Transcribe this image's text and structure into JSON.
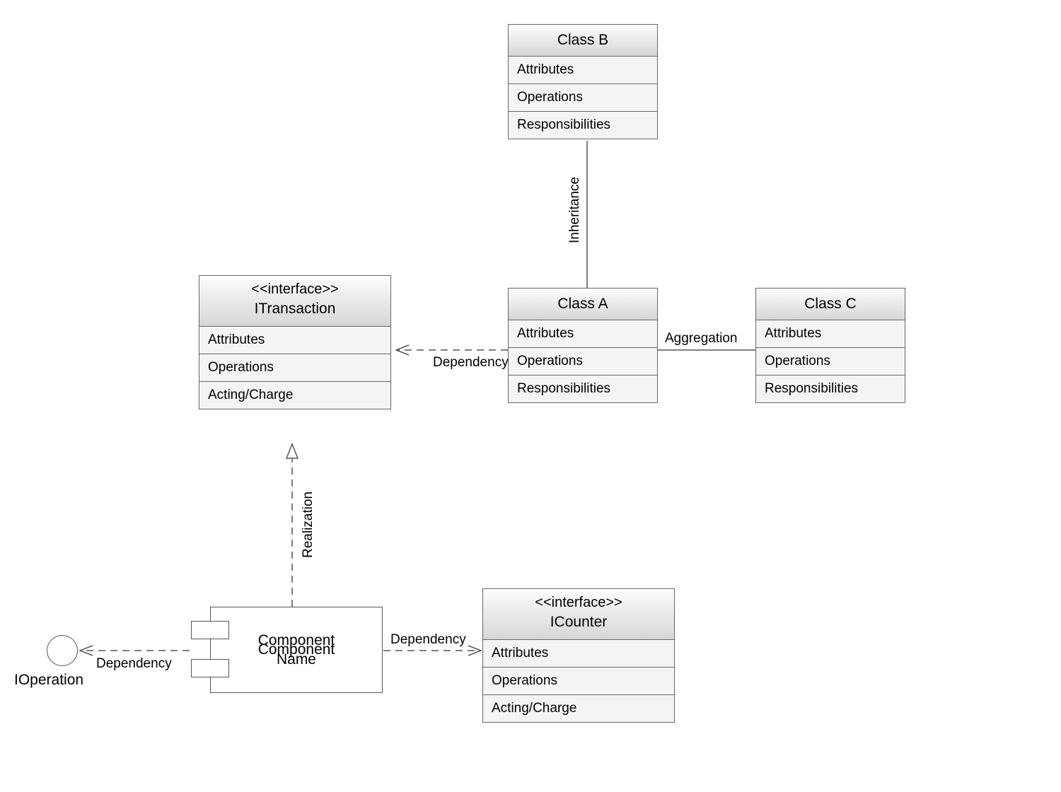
{
  "classes": {
    "itransaction": {
      "stereotype": "<<interface>>",
      "name": "ITransaction",
      "compartments": [
        "Attributes",
        "Operations",
        "Acting/Charge"
      ]
    },
    "classB": {
      "name": "Class B",
      "compartments": [
        "Attributes",
        "Operations",
        "Responsibilities"
      ]
    },
    "classA": {
      "name": "Class A",
      "compartments": [
        "Attributes",
        "Operations",
        "Responsibilities"
      ]
    },
    "classC": {
      "name": "Class C",
      "compartments": [
        "Attributes",
        "Operations",
        "Responsibilities"
      ]
    },
    "icounter": {
      "stereotype": "<<interface>>",
      "name": "ICounter",
      "compartments": [
        "Attributes",
        "Operations",
        "Acting/Charge"
      ]
    }
  },
  "component": {
    "name_line1": "Component",
    "name_line2": "Name"
  },
  "ioperation": {
    "label": "IOperation"
  },
  "edges": {
    "dep_a_to_itx": "Dependency",
    "inh_a_to_b": "Inheritance",
    "agg_a_c": "Aggregation",
    "real_comp_itx": "Realization",
    "dep_comp_icounter": "Dependency",
    "dep_iop_comp": "Dependency"
  }
}
